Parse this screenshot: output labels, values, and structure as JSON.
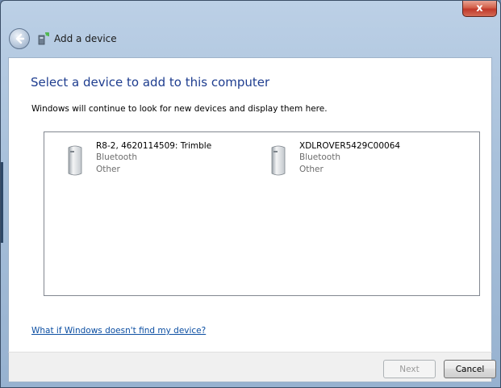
{
  "window": {
    "title": "Add a device",
    "close_label": "x"
  },
  "main": {
    "heading": "Select a device to add to this computer",
    "instruction": "Windows will continue to look for new devices and display them here.",
    "devices": [
      {
        "name": "R8-2, 4620114509: Trimble",
        "type": "Bluetooth",
        "category": "Other"
      },
      {
        "name": "XDLROVER5429C00064",
        "type": "Bluetooth",
        "category": "Other"
      }
    ],
    "help_link": "What if Windows doesn't find my device?"
  },
  "footer": {
    "next_label": "Next",
    "cancel_label": "Cancel"
  },
  "colors": {
    "heading": "#1e3d8f",
    "link": "#0b4ea2",
    "close": "#c0392b"
  }
}
